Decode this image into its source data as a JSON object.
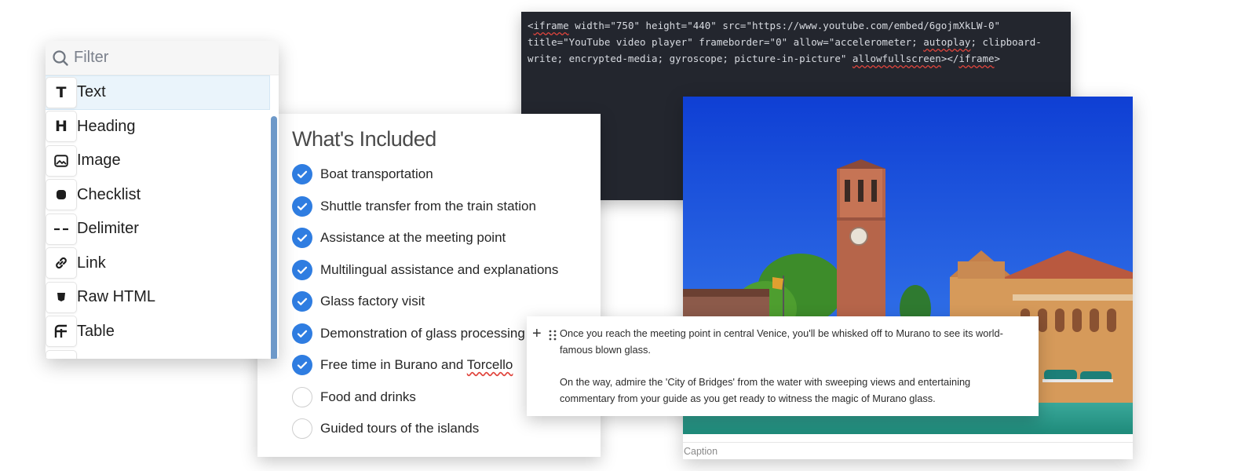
{
  "code": {
    "text_before_1": "<",
    "tag_open": "iframe",
    "text_mid_1": " width=\"750\" height=\"440\" src=\"https://www.youtube.com/embed/6gojmXkLW-0\" title=\"YouTube video player\" frameborder=\"0\" allow=\"accelerometer; ",
    "autoplay": "autoplay",
    "text_mid_2": "; clipboard-write; encrypted-media; gyroscope; picture-in-picture\" ",
    "allowfullscreen": "allowfullscreen",
    "text_mid_3": "></",
    "tag_close": "iframe",
    "text_end": ">"
  },
  "image_card": {
    "caption_placeholder": "Caption",
    "sky_color": "#1a4fd6"
  },
  "checklist": {
    "title": "What's Included",
    "accent_color": "#2f7de1",
    "items": [
      {
        "label": "Boat transportation",
        "checked": true
      },
      {
        "label": "Shuttle transfer from the train station",
        "checked": true
      },
      {
        "label": "Assistance at the meeting point",
        "checked": true
      },
      {
        "label": "Multilingual assistance and explanations",
        "checked": true
      },
      {
        "label": "Glass factory visit",
        "checked": true
      },
      {
        "label": "Demonstration of glass processing",
        "checked": true
      },
      {
        "label_start": "Free time in Burano and ",
        "label_sq": "Torcello",
        "checked": true
      },
      {
        "label": "Food and drinks",
        "checked": false
      },
      {
        "label": "Guided tours of the islands",
        "checked": false
      }
    ]
  },
  "toolbox": {
    "filter_placeholder": "Filter",
    "items": [
      {
        "label": "Text",
        "icon": "text-icon",
        "glyph": "T"
      },
      {
        "label": "Heading",
        "icon": "heading-icon",
        "glyph": "H"
      },
      {
        "label": "Image",
        "icon": "image-icon"
      },
      {
        "label": "Checklist",
        "icon": "checklist-icon"
      },
      {
        "label": "Delimiter",
        "icon": "delimiter-icon"
      },
      {
        "label": "Link",
        "icon": "link-icon"
      },
      {
        "label": "Raw HTML",
        "icon": "html-icon"
      },
      {
        "label": "Table",
        "icon": "table-icon"
      }
    ]
  },
  "text_block": {
    "paragraph_1": "Once you reach the meeting point in central Venice, you'll be whisked off to Murano to see its world-famous blown glass.",
    "paragraph_2": "On the way, admire the 'City of Bridges' from the water with sweeping views and entertaining commentary from your guide as you get ready to witness the magic of Murano glass."
  }
}
